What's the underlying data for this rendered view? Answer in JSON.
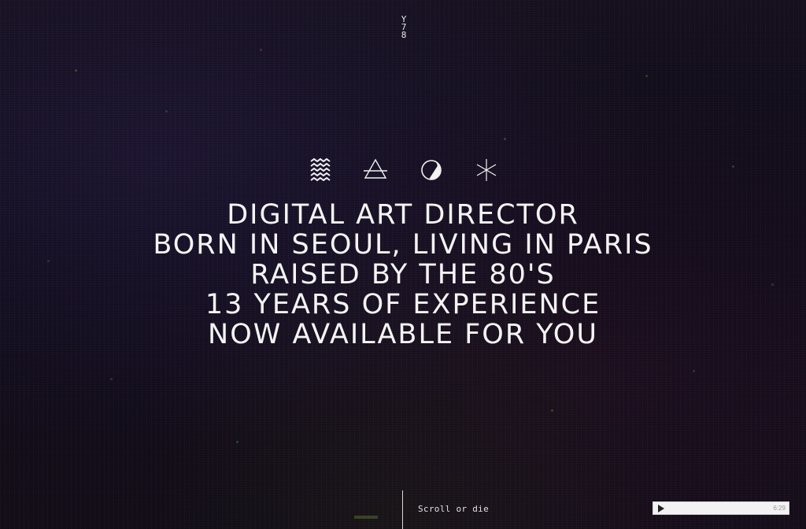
{
  "logo": {
    "lines": [
      "Y",
      "7",
      "8"
    ]
  },
  "icons": [
    "water-waves-icon",
    "air-triangle-icon",
    "half-moon-circle-icon",
    "asterisk-star-icon"
  ],
  "headline": {
    "lines": [
      "DIGITAL ART DIRECTOR",
      "BORN IN SEOUL, LIVING IN PARIS",
      "RAISED BY THE 80'S",
      "13 YEARS OF EXPERIENCE",
      "NOW AVAILABLE FOR YOU"
    ]
  },
  "footer": {
    "scroll_label": "Scroll or die"
  },
  "player": {
    "time": "6:29",
    "play_icon": "play-icon"
  },
  "colors": {
    "background": "#120d1c",
    "text": "#f4f4f4",
    "player_bg": "#f2f2f2"
  }
}
